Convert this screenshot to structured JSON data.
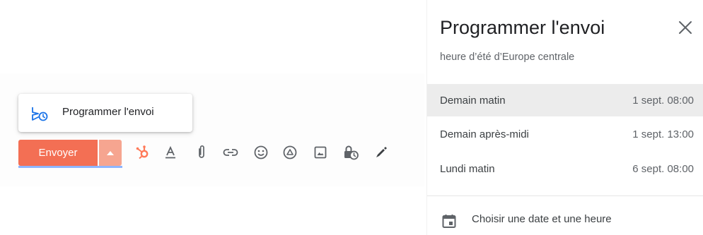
{
  "popup": {
    "schedule_label": "Programmer l'envoi",
    "icon": "schedule-send-icon"
  },
  "compose": {
    "send_label": "Envoyer",
    "toolbar_icons": [
      "hubspot-icon",
      "text-format-icon",
      "attach-icon",
      "link-icon",
      "emoji-icon",
      "drive-icon",
      "image-icon",
      "confidential-mode-icon",
      "signature-icon"
    ],
    "colors": {
      "send": "#f36f54",
      "dropdown": "#f6a590",
      "hubspot": "#ff7a59"
    }
  },
  "panel": {
    "title": "Programmer l'envoi",
    "timezone": "heure d’été d’Europe centrale",
    "options": [
      {
        "label": "Demain matin",
        "time": "1 sept. 08:00",
        "selected": true
      },
      {
        "label": "Demain après-midi",
        "time": "1 sept. 13:00",
        "selected": false
      },
      {
        "label": "Lundi matin",
        "time": "6 sept. 08:00",
        "selected": false
      }
    ],
    "custom_label": "Choisir une date et une heure"
  }
}
